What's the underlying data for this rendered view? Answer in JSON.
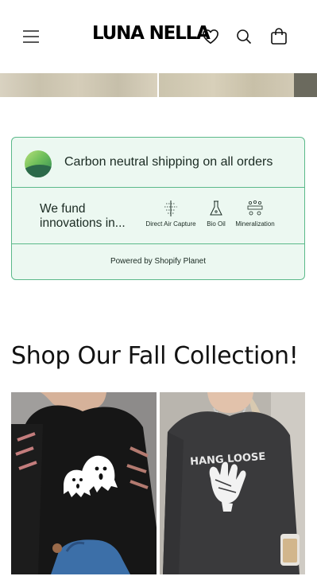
{
  "header": {
    "logo": "LUNA NELLA",
    "icons": [
      "hamburger-menu-icon",
      "heart-icon",
      "search-icon",
      "shopping-bag-icon"
    ]
  },
  "planet": {
    "headline": "Carbon neutral shipping on all orders",
    "fund_text": "We fund innovations in...",
    "projects": [
      "Direct Air Capture",
      "Bio Oil",
      "Mineralization"
    ],
    "powered_by": "Powered by Shopify Planet",
    "colors": {
      "border": "#5bb98a",
      "background": "#ecf8f1"
    }
  },
  "collection": {
    "title": "Shop Our Fall Collection!",
    "products": [
      {
        "graphic_text": "",
        "image": "black sweatshirt with ghost graphic"
      },
      {
        "graphic_text": "HANG LOOSE",
        "image": "charcoal sweatshirt with skeleton hand graphic"
      }
    ]
  }
}
